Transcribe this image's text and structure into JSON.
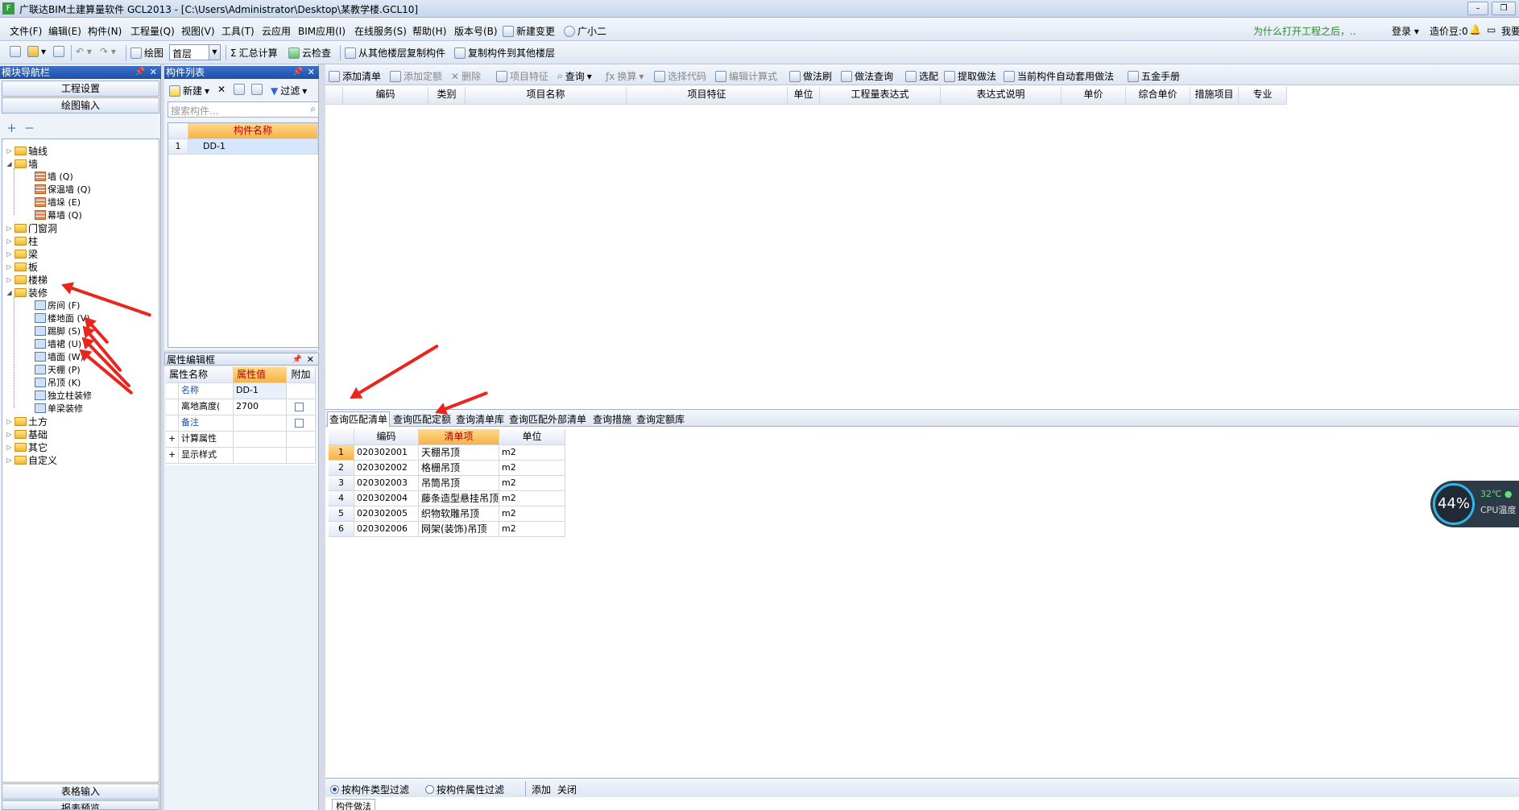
{
  "window": {
    "title": "广联达BIM土建算量软件 GCL2013 - [C:\\Users\\Administrator\\Desktop\\某教学楼.GCL10]",
    "app_icon": "app-icon",
    "min": "▭",
    "max": "▭"
  },
  "menubar": {
    "items": [
      "文件(F)",
      "编辑(E)",
      "构件(N)",
      "工程量(Q)",
      "视图(V)",
      "工具(T)",
      "云应用",
      "BIM应用(I)",
      "在线服务(S)",
      "帮助(H)",
      "版本号(B)",
      "新建变更",
      "广小二"
    ],
    "hint": "为什么打开工程之后，..",
    "login": "登录",
    "points": "造价豆:0",
    "more": "我要"
  },
  "toolbar1": {
    "draw": "绘图",
    "floor": "首层",
    "sum": "汇总计算",
    "cloud_check": "云检查",
    "copy_from": "从其他楼层复制构件",
    "copy_to": "复制构件到其他楼层"
  },
  "nav": {
    "title": "模块导航栏",
    "project_settings": "工程设置",
    "drawing_input": "绘图输入",
    "table_input": "表格输入",
    "report": "报表预览",
    "tree": [
      {
        "label": "轴线",
        "level": 0,
        "type": "folder",
        "expand": "▷"
      },
      {
        "label": "墙",
        "level": 0,
        "type": "folder",
        "expand": "◢"
      },
      {
        "label": "墙 (Q)",
        "level": 1,
        "type": "brick"
      },
      {
        "label": "保温墙 (Q)",
        "level": 1,
        "type": "brick"
      },
      {
        "label": "墙垛 (E)",
        "level": 1,
        "type": "brick"
      },
      {
        "label": "幕墙 (Q)",
        "level": 1,
        "type": "brick"
      },
      {
        "label": "门窗洞",
        "level": 0,
        "type": "folder",
        "expand": "▷"
      },
      {
        "label": "柱",
        "level": 0,
        "type": "folder",
        "expand": "▷"
      },
      {
        "label": "梁",
        "level": 0,
        "type": "folder",
        "expand": "▷"
      },
      {
        "label": "板",
        "level": 0,
        "type": "folder",
        "expand": "▷"
      },
      {
        "label": "楼梯",
        "level": 0,
        "type": "folder",
        "expand": "▷"
      },
      {
        "label": "装修",
        "level": 0,
        "type": "folder",
        "expand": "◢"
      },
      {
        "label": "房间 (F)",
        "level": 1,
        "type": "leaf"
      },
      {
        "label": "楼地面 (V)",
        "level": 1,
        "type": "leaf"
      },
      {
        "label": "踢脚 (S)",
        "level": 1,
        "type": "leaf"
      },
      {
        "label": "墙裙 (U)",
        "level": 1,
        "type": "leaf"
      },
      {
        "label": "墙面 (W)",
        "level": 1,
        "type": "leaf"
      },
      {
        "label": "天棚 (P)",
        "level": 1,
        "type": "leaf"
      },
      {
        "label": "吊顶 (K)",
        "level": 1,
        "type": "leaf"
      },
      {
        "label": "独立柱装修",
        "level": 1,
        "type": "leaf"
      },
      {
        "label": "单梁装修",
        "level": 1,
        "type": "leaf"
      },
      {
        "label": "土方",
        "level": 0,
        "type": "folder",
        "expand": "▷"
      },
      {
        "label": "基础",
        "level": 0,
        "type": "folder",
        "expand": "▷"
      },
      {
        "label": "其它",
        "level": 0,
        "type": "folder",
        "expand": "▷"
      },
      {
        "label": "自定义",
        "level": 0,
        "type": "folder",
        "expand": "▷"
      }
    ]
  },
  "complist": {
    "title": "构件列表",
    "new": "新建",
    "filter": "过滤",
    "search_placeholder": "搜索构件...",
    "header": "构件名称",
    "rows": [
      {
        "num": "1",
        "name": "DD-1"
      }
    ]
  },
  "propedit": {
    "title": "属性编辑框",
    "headers": [
      "属性名称",
      "属性值",
      "附加"
    ],
    "rows": [
      {
        "num": "",
        "name": "名称",
        "value": "DD-1",
        "blue": true
      },
      {
        "num": "",
        "name": "离地高度(",
        "value": "2700",
        "blue": false
      },
      {
        "num": "",
        "name": "备注",
        "value": "",
        "blue": true
      },
      {
        "num": "+",
        "name": "计算属性",
        "value": "",
        "blue": false
      },
      {
        "num": "+",
        "name": "显示样式",
        "value": "",
        "blue": false
      }
    ]
  },
  "main_toolbar": {
    "add_list": "添加清单",
    "add_quota": "添加定额",
    "delete": "删除",
    "item_feature": "项目特征",
    "query": "查询",
    "convert": "换算",
    "select_code": "选择代码",
    "edit_formula": "编辑计算式",
    "method_brush": "做法刷",
    "method_query": "做法查询",
    "match": "选配",
    "extract": "提取做法",
    "auto_apply": "当前构件自动套用做法",
    "hardware": "五金手册"
  },
  "main_table": {
    "headers": [
      "编码",
      "类别",
      "项目名称",
      "项目特征",
      "单位",
      "工程量表达式",
      "表达式说明",
      "单价",
      "综合单价",
      "措施项目",
      "专业"
    ]
  },
  "tabs": [
    "查询匹配清单",
    "查询匹配定额",
    "查询清单库",
    "查询匹配外部清单",
    "查询措施",
    "查询定额库"
  ],
  "query_table": {
    "headers": [
      "编码",
      "清单项",
      "单位"
    ],
    "rows": [
      {
        "num": "1",
        "code": "020302001",
        "name": "天棚吊顶",
        "unit": "m2"
      },
      {
        "num": "2",
        "code": "020302002",
        "name": "格栅吊顶",
        "unit": "m2"
      },
      {
        "num": "3",
        "code": "020302003",
        "name": "吊筒吊顶",
        "unit": "m2"
      },
      {
        "num": "4",
        "code": "020302004",
        "name": "藤条造型悬挂吊顶",
        "unit": "m2"
      },
      {
        "num": "5",
        "code": "020302005",
        "name": "织物软雕吊顶",
        "unit": "m2"
      },
      {
        "num": "6",
        "code": "020302006",
        "name": "网架(装饰)吊顶",
        "unit": "m2"
      }
    ]
  },
  "bottom_bar": {
    "filter_type": "按构件类型过滤",
    "filter_prop": "按构件属性过滤",
    "add": "添加",
    "close": "关闭",
    "tab": "构件做法"
  },
  "widget": {
    "percent": "44%",
    "temp": "32℃",
    "label": "CPU温度"
  },
  "colors": {
    "annotation_arrow": "#e8261e",
    "panel_header": "#1d4fa8",
    "highlight_header": "#f5b348"
  }
}
